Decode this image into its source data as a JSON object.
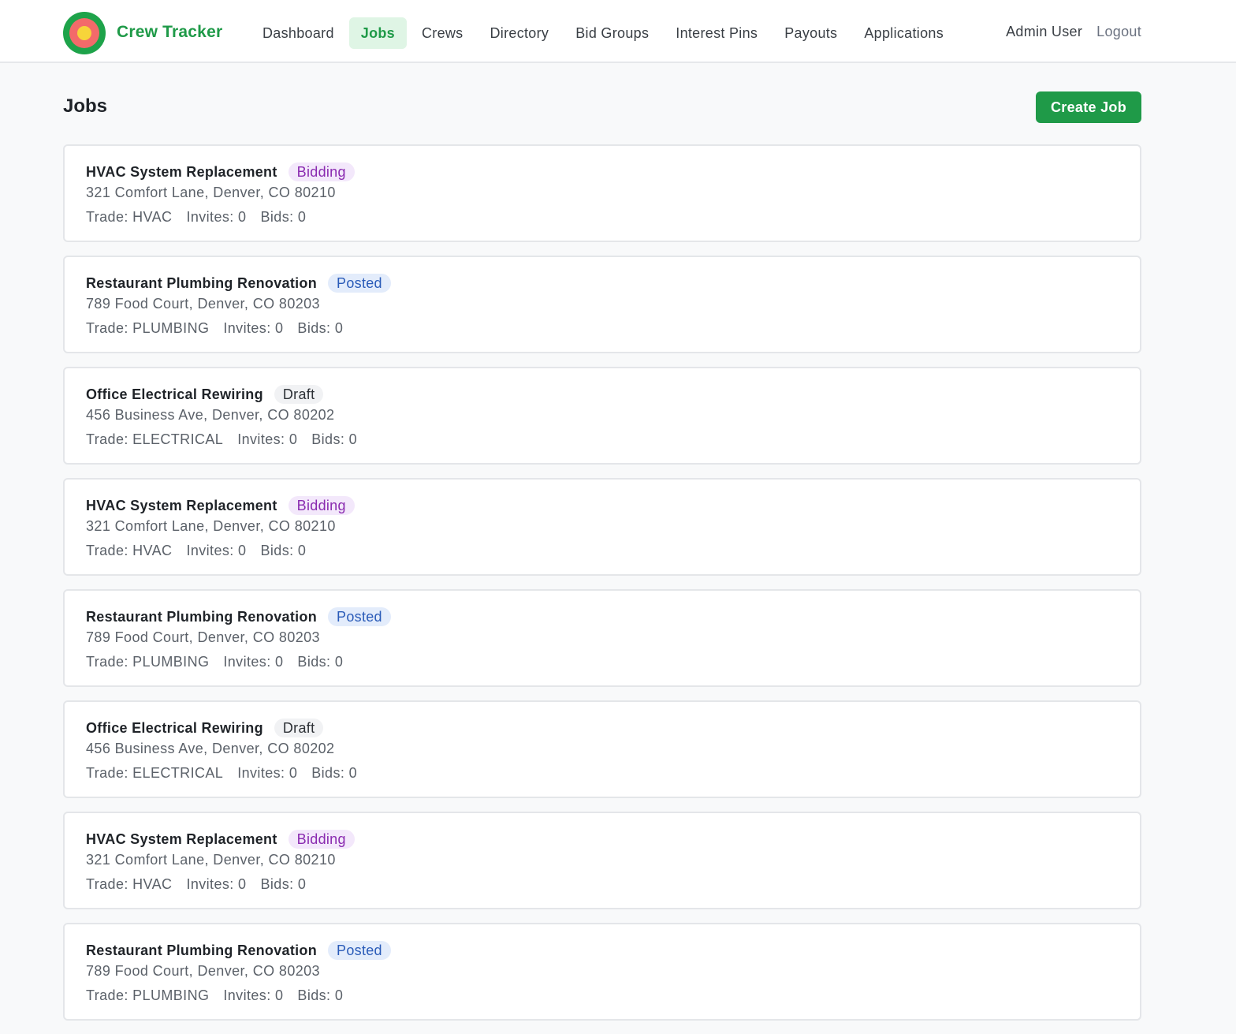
{
  "app": {
    "brand": "Crew Tracker"
  },
  "nav": {
    "items": [
      "Dashboard",
      "Jobs",
      "Crews",
      "Directory",
      "Bid Groups",
      "Interest Pins",
      "Payouts",
      "Applications"
    ],
    "active": "Jobs"
  },
  "user": {
    "name": "Admin User",
    "logout_label": "Logout"
  },
  "page": {
    "title": "Jobs",
    "create_label": "Create Job"
  },
  "colors": {
    "brand_green": "#1f9a48",
    "bidding": "#8a2bb0",
    "posted": "#2a5bb8",
    "draft": "#2d3136"
  },
  "jobs": [
    {
      "title": "HVAC System Replacement",
      "status": "Bidding",
      "status_key": "bidding",
      "address": "321 Comfort Lane, Denver, CO 80210",
      "trade": "Trade: HVAC",
      "invites": "Invites: 0",
      "bids": "Bids: 0"
    },
    {
      "title": "Restaurant Plumbing Renovation",
      "status": "Posted",
      "status_key": "posted",
      "address": "789 Food Court, Denver, CO 80203",
      "trade": "Trade: PLUMBING",
      "invites": "Invites: 0",
      "bids": "Bids: 0"
    },
    {
      "title": "Office Electrical Rewiring",
      "status": "Draft",
      "status_key": "draft",
      "address": "456 Business Ave, Denver, CO 80202",
      "trade": "Trade: ELECTRICAL",
      "invites": "Invites: 0",
      "bids": "Bids: 0"
    },
    {
      "title": "HVAC System Replacement",
      "status": "Bidding",
      "status_key": "bidding",
      "address": "321 Comfort Lane, Denver, CO 80210",
      "trade": "Trade: HVAC",
      "invites": "Invites: 0",
      "bids": "Bids: 0"
    },
    {
      "title": "Restaurant Plumbing Renovation",
      "status": "Posted",
      "status_key": "posted",
      "address": "789 Food Court, Denver, CO 80203",
      "trade": "Trade: PLUMBING",
      "invites": "Invites: 0",
      "bids": "Bids: 0"
    },
    {
      "title": "Office Electrical Rewiring",
      "status": "Draft",
      "status_key": "draft",
      "address": "456 Business Ave, Denver, CO 80202",
      "trade": "Trade: ELECTRICAL",
      "invites": "Invites: 0",
      "bids": "Bids: 0"
    },
    {
      "title": "HVAC System Replacement",
      "status": "Bidding",
      "status_key": "bidding",
      "address": "321 Comfort Lane, Denver, CO 80210",
      "trade": "Trade: HVAC",
      "invites": "Invites: 0",
      "bids": "Bids: 0"
    },
    {
      "title": "Restaurant Plumbing Renovation",
      "status": "Posted",
      "status_key": "posted",
      "address": "789 Food Court, Denver, CO 80203",
      "trade": "Trade: PLUMBING",
      "invites": "Invites: 0",
      "bids": "Bids: 0"
    }
  ]
}
